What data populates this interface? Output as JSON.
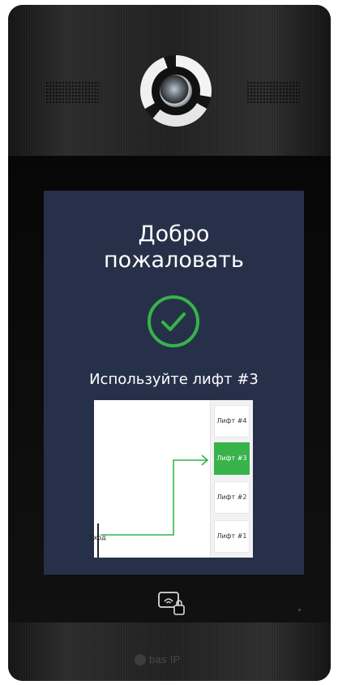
{
  "screen": {
    "title_lines": [
      "Добро",
      "пожаловать"
    ],
    "status": "success-check",
    "instruction": "Используйте лифт #3"
  },
  "map": {
    "entrance_label": "Вход",
    "floors": [
      {
        "label": "Лифт #4",
        "active": false
      },
      {
        "label": "Лифт #3",
        "active": true
      },
      {
        "label": "Лифт #2",
        "active": false
      },
      {
        "label": "Лифт #1",
        "active": false
      }
    ],
    "route_color": "#37b34a"
  },
  "device": {
    "brand": "bas IP",
    "icons": [
      "camera-icon",
      "nfc-reader-icon",
      "lock-icon"
    ]
  },
  "colors": {
    "screen_bg": "#263149",
    "accent_green": "#37b34a",
    "text": "#ffffff"
  }
}
